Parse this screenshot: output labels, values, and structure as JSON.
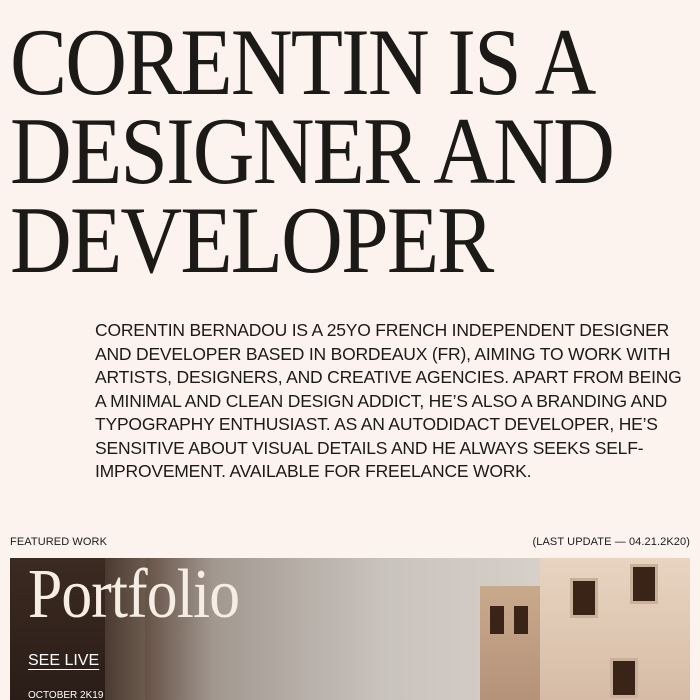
{
  "hero": {
    "line1": "Corentin is a",
    "line2": "designer and",
    "line3": "developer"
  },
  "bio": "Corentin Bernadou is a 25yo French independent designer and developer based in Bordeaux (FR), aiming to work with artists, designers, and creative agencies. Apart from being a minimal and clean design addict, he’s also a branding and typography enthusiast. As an autodidact developer, he’s sensitive about visual details and he always seeks self-improvement. Available for freelance work.",
  "featured": {
    "label": "Featured work",
    "last_update": "(Last update — 04.21.2K20)"
  },
  "card": {
    "title": "Portfolio",
    "link_label": "See live",
    "date": "October 2K19"
  }
}
